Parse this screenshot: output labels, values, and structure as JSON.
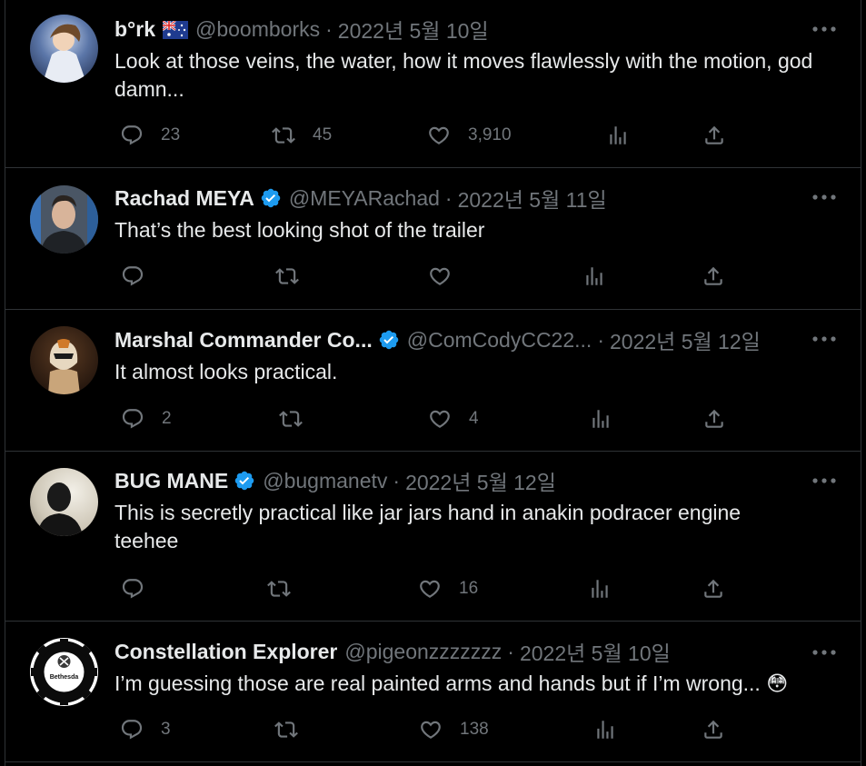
{
  "tweets": [
    {
      "name": "b°rk",
      "has_flag": true,
      "verified": false,
      "handle": "@boomborks",
      "date": "2022년 5월 10일",
      "text": "Look at those veins, the water, how it moves flawlessly with the motion, god damn...",
      "replies": "23",
      "retweets": "45",
      "likes": "3,910"
    },
    {
      "name": "Rachad MEYA",
      "has_flag": false,
      "verified": true,
      "handle": "@MEYARachad",
      "date": "2022년 5월 11일",
      "text": "That’s the best looking shot of the trailer",
      "replies": "",
      "retweets": "",
      "likes": ""
    },
    {
      "name": "Marshal Commander Co...",
      "has_flag": false,
      "verified": true,
      "handle": "@ComCodyCC22...",
      "date": "2022년 5월 12일",
      "text": "It almost looks practical.",
      "replies": "2",
      "retweets": "",
      "likes": "4"
    },
    {
      "name": "BUG MANE",
      "has_flag": false,
      "verified": true,
      "handle": "@bugmanetv",
      "date": "2022년 5월 12일",
      "text": "This is secretly practical like jar jars hand in anakin podracer engine teehee",
      "replies": "",
      "retweets": "",
      "likes": "16"
    },
    {
      "name": "Constellation Explorer",
      "has_flag": false,
      "verified": false,
      "handle": "@pigeonzzzzzzz",
      "date": "2022년 5월 10일",
      "text": "I’m guessing those are real painted arms and hands but if I’m wrong...",
      "emoji": "😳",
      "avatar_logo_text": "Bethesda",
      "replies": "3",
      "retweets": "",
      "likes": "138"
    }
  ],
  "separator": "·",
  "colors": {
    "background": "#000000",
    "text": "#e7e9ea",
    "muted": "#71767b",
    "border": "#2f3336",
    "verified": "#1d9bf0"
  },
  "icons": [
    "reply-icon",
    "retweet-icon",
    "like-icon",
    "views-icon",
    "share-icon",
    "more-icon",
    "verified-icon"
  ]
}
